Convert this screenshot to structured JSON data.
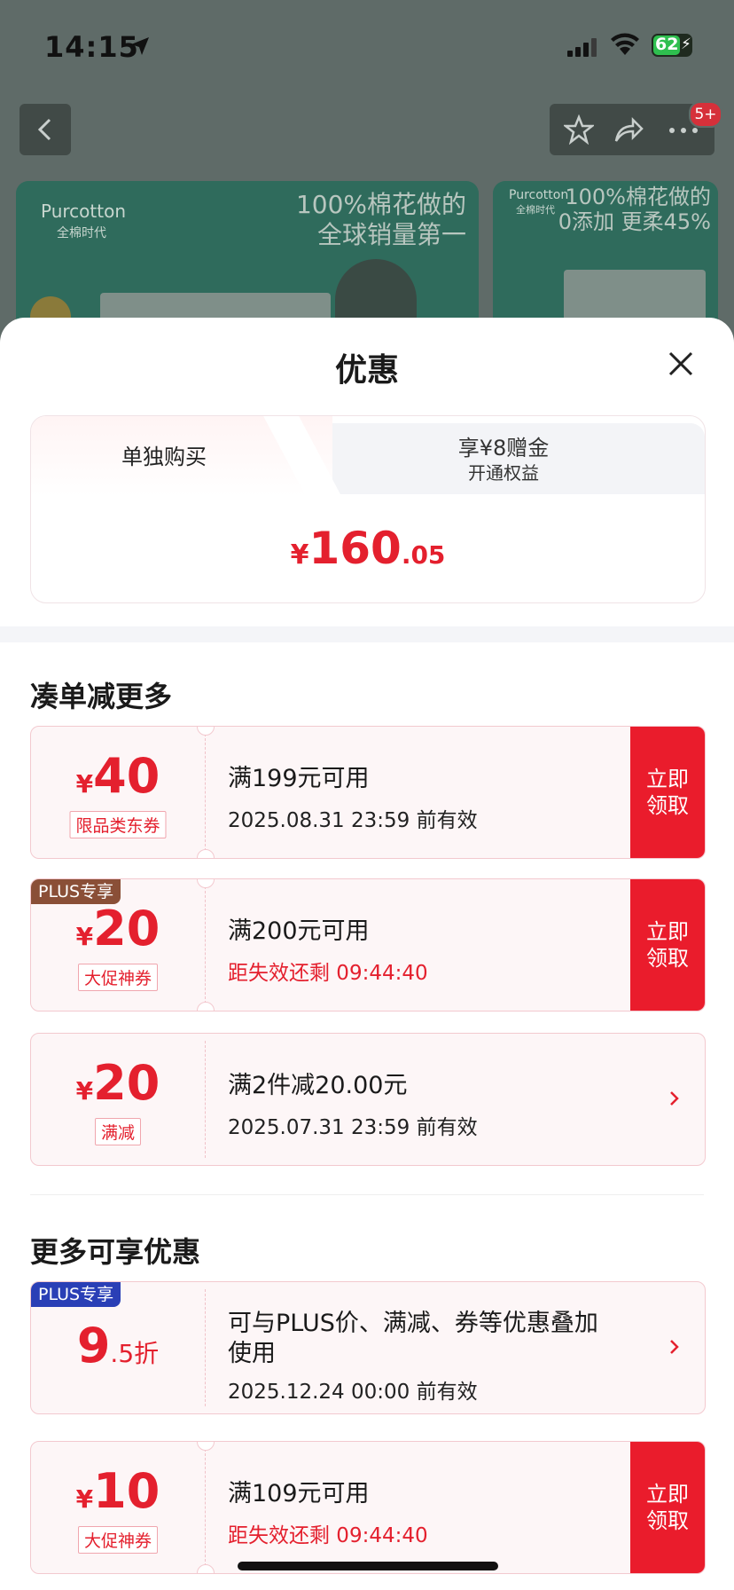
{
  "status_bar": {
    "time": "14:15",
    "battery": "62"
  },
  "top_bar": {
    "badge": "5+"
  },
  "banners": [
    {
      "brand": "Purcotton",
      "brand_sub": "全棉时代",
      "slogan_line1": "100%棉花做的",
      "slogan_line2": "全球销量第一"
    },
    {
      "brand": "Purcotton",
      "brand_sub": "全棉时代",
      "slogan_line1": "100%棉花做的",
      "slogan_line2": "0添加 更柔45%"
    }
  ],
  "sheet": {
    "title": "优惠",
    "tabs": {
      "tab1": "单独购买",
      "tab2_line1": "享¥8赠金",
      "tab2_line2": "开通权益"
    },
    "price": {
      "currency": "¥",
      "integer": "160",
      "decimal": ".05"
    }
  },
  "section1_title": "凑单减更多",
  "section2_title": "更多可享优惠",
  "coupons": [
    {
      "currency": "¥",
      "amount": "40",
      "tag": "限品类东券",
      "line1": "满199元可用",
      "line2": "2025.08.31 23:59 前有效",
      "action": "立即\n领取"
    },
    {
      "plus": "PLUS专享",
      "currency": "¥",
      "amount": "20",
      "tag": "大促神券",
      "line1": "满200元可用",
      "line2": "距失效还剩 09:44:40",
      "action": "立即\n领取"
    },
    {
      "currency": "¥",
      "amount": "20",
      "tag": "满减",
      "line1": "满2件减20.00元",
      "line2": "2025.07.31 23:59 前有效"
    },
    {
      "plus": "PLUS专享",
      "amount": "9",
      "suffix": ".5折",
      "line1": "可与PLUS价、满减、券等优惠叠加",
      "line1b": "使用",
      "line2": "2025.12.24 00:00 前有效"
    },
    {
      "currency": "¥",
      "amount": "10",
      "tag": "大促神券",
      "line1": "满109元可用",
      "line2": "距失效还剩 09:44:40",
      "action": "立即\n领取"
    }
  ],
  "colors": {
    "accent_red": "#e4202e",
    "claim_red": "#ea1c2c",
    "plus_brown": "#8a4f37",
    "plus_blue": "#2a3fb6"
  },
  "icons": [
    "back-arrow-icon",
    "star-icon",
    "share-icon",
    "more-icon",
    "close-icon",
    "chevron-right-icon",
    "location-arrow-icon",
    "signal-icon",
    "wifi-icon",
    "battery-icon"
  ]
}
